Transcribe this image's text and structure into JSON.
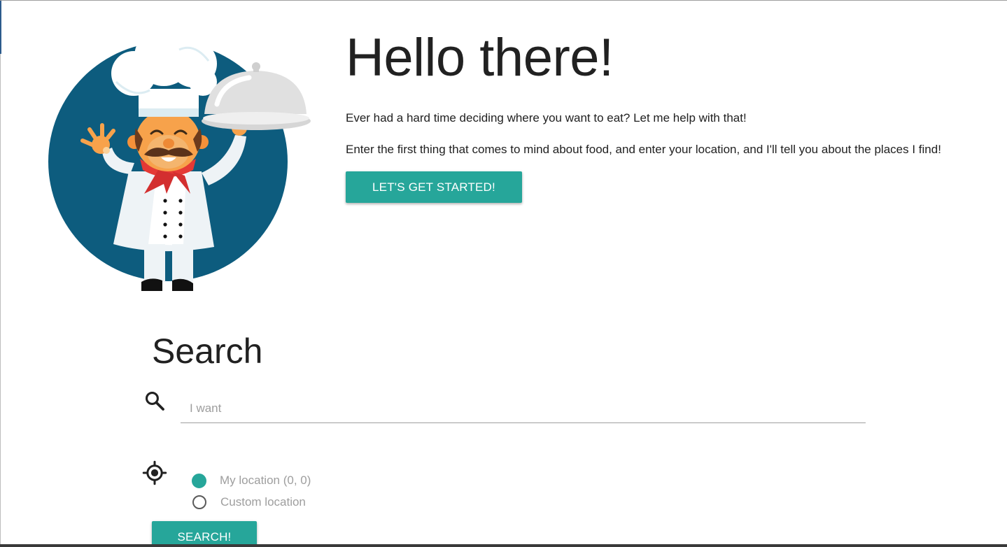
{
  "hero": {
    "title": "Hello there!",
    "paragraph1": "Ever had a hard time deciding where you want to eat? Let me help with that!",
    "paragraph2": "Enter the first thing that comes to mind about food, and enter your location, and I'll tell you about the places I find!",
    "cta_label": "LET'S GET STARTED!",
    "illustration": "chef-holding-cloche"
  },
  "search": {
    "title": "Search",
    "icon": "search-icon",
    "input_value": "",
    "input_placeholder": "I want",
    "location_icon": "gps-target-icon",
    "location_options": [
      {
        "label": "My location (0, 0)",
        "selected": true
      },
      {
        "label": "Custom location",
        "selected": false
      }
    ],
    "submit_label": "SEARCH!"
  },
  "colors": {
    "accent": "#26a69a",
    "chef_circle": "#0d5c7e",
    "text": "#212121",
    "muted_text": "#9e9e9e"
  }
}
